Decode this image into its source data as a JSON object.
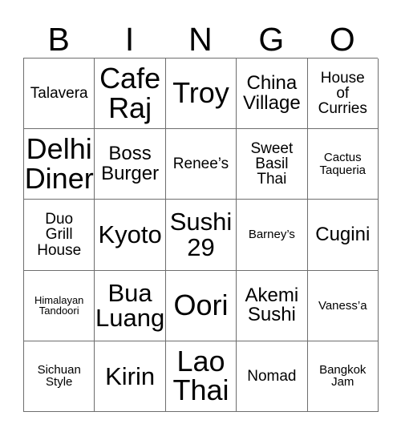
{
  "card": {
    "headers": [
      "B",
      "I",
      "N",
      "G",
      "O"
    ],
    "rows": [
      [
        {
          "text": "Talavera",
          "size": "fs-sm"
        },
        {
          "text": "Cafe\nRaj",
          "size": "fs-xl"
        },
        {
          "text": "Troy",
          "size": "fs-xl"
        },
        {
          "text": "China\nVillage",
          "size": "fs-md"
        },
        {
          "text": "House\nof\nCurries",
          "size": "fs-sm"
        }
      ],
      [
        {
          "text": "Delhi\nDiner",
          "size": "fs-xl"
        },
        {
          "text": "Boss\nBurger",
          "size": "fs-md"
        },
        {
          "text": "Renee’s",
          "size": "fs-sm"
        },
        {
          "text": "Sweet\nBasil\nThai",
          "size": "fs-sm"
        },
        {
          "text": "Cactus\nTaqueria",
          "size": "fs-xs"
        }
      ],
      [
        {
          "text": "Duo\nGrill\nHouse",
          "size": "fs-sm"
        },
        {
          "text": "Kyoto",
          "size": "fs-lg"
        },
        {
          "text": "Sushi\n29",
          "size": "fs-lg"
        },
        {
          "text": "Barney’s",
          "size": "fs-xs"
        },
        {
          "text": "Cugini",
          "size": "fs-md"
        }
      ],
      [
        {
          "text": "Himalayan\nTandoori",
          "size": "fs-xxs"
        },
        {
          "text": "Bua\nLuang",
          "size": "fs-lg"
        },
        {
          "text": "Oori",
          "size": "fs-xl"
        },
        {
          "text": "Akemi\nSushi",
          "size": "fs-md"
        },
        {
          "text": "Vaness’a",
          "size": "fs-xs"
        }
      ],
      [
        {
          "text": "Sichuan\nStyle",
          "size": "fs-xs"
        },
        {
          "text": "Kirin",
          "size": "fs-lg"
        },
        {
          "text": "Lao\nThai",
          "size": "fs-xl"
        },
        {
          "text": "Nomad",
          "size": "fs-sm"
        },
        {
          "text": "Bangkok\nJam",
          "size": "fs-xs"
        }
      ]
    ]
  },
  "colors": {
    "border": "#6e6e6e",
    "text": "#000000",
    "background": "#ffffff"
  }
}
